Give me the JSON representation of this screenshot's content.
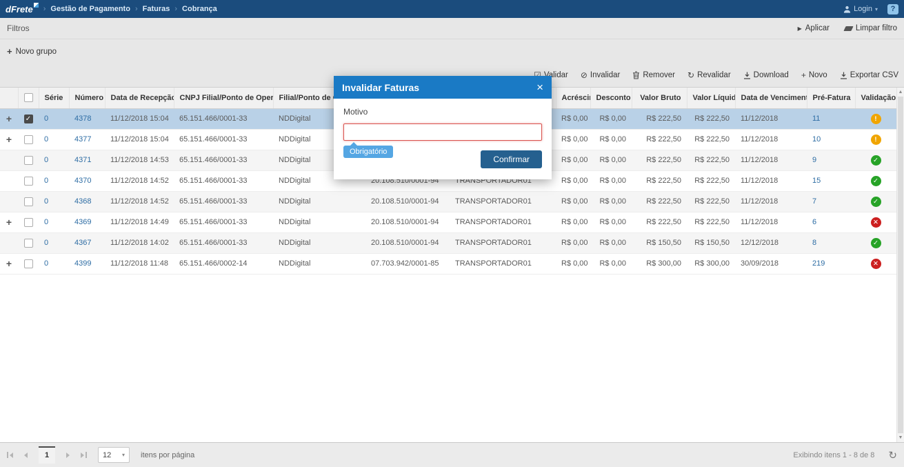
{
  "navbar": {
    "logo": "dFrete",
    "breadcrumbs": [
      "Gestão de Pagamento",
      "Faturas",
      "Cobrança"
    ],
    "login_label": "Login",
    "help_icon": "?"
  },
  "filters": {
    "title": "Filtros",
    "apply_label": "Aplicar",
    "clear_label": "Limpar filtro",
    "new_group_label": "Novo grupo"
  },
  "toolbar": {
    "actions": [
      {
        "label": "Validar",
        "icon": "check_square"
      },
      {
        "label": "Invalidar",
        "icon": "slash_circle"
      },
      {
        "label": "Remover",
        "icon": "trash"
      },
      {
        "label": "Revalidar",
        "icon": "refresh"
      },
      {
        "label": "Download",
        "icon": "download"
      },
      {
        "label": "Novo",
        "icon": "plus"
      },
      {
        "label": "Exportar CSV",
        "icon": "download"
      }
    ]
  },
  "table": {
    "columns": [
      {
        "label": "",
        "name": "expand"
      },
      {
        "label": "",
        "name": "select"
      },
      {
        "label": "Série",
        "name": "serie"
      },
      {
        "label": "Número",
        "name": "numero"
      },
      {
        "label": "Data de Recepção",
        "name": "data-recepcao",
        "sorted": "desc"
      },
      {
        "label": "CNPJ Filial/Ponto de Operação",
        "name": "cnpj-filial"
      },
      {
        "label": "Filial/Ponto de Operação",
        "name": "filial"
      },
      {
        "label": "",
        "name": "cnpj-transportador"
      },
      {
        "label": "",
        "name": "transportador"
      },
      {
        "label": "Acréscimo",
        "name": "acrescimo",
        "align": "right"
      },
      {
        "label": "Desconto",
        "name": "desconto",
        "align": "right"
      },
      {
        "label": "Valor Bruto",
        "name": "valor-bruto",
        "align": "right"
      },
      {
        "label": "Valor Líquido",
        "name": "valor-liquido",
        "align": "right"
      },
      {
        "label": "Data de Vencimento",
        "name": "data-vencimento"
      },
      {
        "label": "Pré-Fatura",
        "name": "pre-fatura"
      },
      {
        "label": "Validação",
        "name": "validacao",
        "align": "center"
      }
    ],
    "rows": [
      {
        "expand": true,
        "checked": true,
        "selected": true,
        "serie": "0",
        "numero": "4378",
        "data_recepcao": "11/12/2018 15:04",
        "cnpj_filial": "65.151.466/0001-33",
        "filial": "NDDigital",
        "cnpj_transportador": "",
        "transportador": "",
        "acrescimo": "R$ 0,00",
        "desconto": "R$ 0,00",
        "valor_bruto": "R$ 222,50",
        "valor_liquido": "R$ 222,50",
        "data_vencimento": "11/12/2018",
        "pre_fatura": "11",
        "validacao": "warning"
      },
      {
        "expand": true,
        "checked": false,
        "selected": false,
        "serie": "0",
        "numero": "4377",
        "data_recepcao": "11/12/2018 15:04",
        "cnpj_filial": "65.151.466/0001-33",
        "filial": "NDDigital",
        "cnpj_transportador": "",
        "transportador": "",
        "acrescimo": "R$ 0,00",
        "desconto": "R$ 0,00",
        "valor_bruto": "R$ 222,50",
        "valor_liquido": "R$ 222,50",
        "data_vencimento": "11/12/2018",
        "pre_fatura": "10",
        "validacao": "warning"
      },
      {
        "expand": false,
        "checked": false,
        "selected": false,
        "serie": "0",
        "numero": "4371",
        "data_recepcao": "11/12/2018 14:53",
        "cnpj_filial": "65.151.466/0001-33",
        "filial": "NDDigital",
        "cnpj_transportador": "",
        "transportador": "",
        "acrescimo": "R$ 0,00",
        "desconto": "R$ 0,00",
        "valor_bruto": "R$ 222,50",
        "valor_liquido": "R$ 222,50",
        "data_vencimento": "11/12/2018",
        "pre_fatura": "9",
        "validacao": "valid"
      },
      {
        "expand": false,
        "checked": false,
        "selected": false,
        "serie": "0",
        "numero": "4370",
        "data_recepcao": "11/12/2018 14:52",
        "cnpj_filial": "65.151.466/0001-33",
        "filial": "NDDigital",
        "cnpj_transportador": "20.108.510/0001-94",
        "transportador": "TRANSPORTADOR01",
        "acrescimo": "R$ 0,00",
        "desconto": "R$ 0,00",
        "valor_bruto": "R$ 222,50",
        "valor_liquido": "R$ 222,50",
        "data_vencimento": "11/12/2018",
        "pre_fatura": "15",
        "validacao": "valid"
      },
      {
        "expand": false,
        "checked": false,
        "selected": false,
        "serie": "0",
        "numero": "4368",
        "data_recepcao": "11/12/2018 14:52",
        "cnpj_filial": "65.151.466/0001-33",
        "filial": "NDDigital",
        "cnpj_transportador": "20.108.510/0001-94",
        "transportador": "TRANSPORTADOR01",
        "acrescimo": "R$ 0,00",
        "desconto": "R$ 0,00",
        "valor_bruto": "R$ 222,50",
        "valor_liquido": "R$ 222,50",
        "data_vencimento": "11/12/2018",
        "pre_fatura": "7",
        "validacao": "valid"
      },
      {
        "expand": true,
        "checked": false,
        "selected": false,
        "serie": "0",
        "numero": "4369",
        "data_recepcao": "11/12/2018 14:49",
        "cnpj_filial": "65.151.466/0001-33",
        "filial": "NDDigital",
        "cnpj_transportador": "20.108.510/0001-94",
        "transportador": "TRANSPORTADOR01",
        "acrescimo": "R$ 0,00",
        "desconto": "R$ 0,00",
        "valor_bruto": "R$ 222,50",
        "valor_liquido": "R$ 222,50",
        "data_vencimento": "11/12/2018",
        "pre_fatura": "6",
        "validacao": "invalid"
      },
      {
        "expand": false,
        "checked": false,
        "selected": false,
        "serie": "0",
        "numero": "4367",
        "data_recepcao": "11/12/2018 14:02",
        "cnpj_filial": "65.151.466/0001-33",
        "filial": "NDDigital",
        "cnpj_transportador": "20.108.510/0001-94",
        "transportador": "TRANSPORTADOR01",
        "acrescimo": "R$ 0,00",
        "desconto": "R$ 0,00",
        "valor_bruto": "R$ 150,50",
        "valor_liquido": "R$ 150,50",
        "data_vencimento": "12/12/2018",
        "pre_fatura": "8",
        "validacao": "valid"
      },
      {
        "expand": true,
        "checked": false,
        "selected": false,
        "serie": "0",
        "numero": "4399",
        "data_recepcao": "11/12/2018 11:48",
        "cnpj_filial": "65.151.466/0002-14",
        "filial": "NDDigital",
        "cnpj_transportador": "07.703.942/0001-85",
        "transportador": "TRANSPORTADOR01",
        "acrescimo": "R$ 0,00",
        "desconto": "R$ 0,00",
        "valor_bruto": "R$ 300,00",
        "valor_liquido": "R$ 300,00",
        "data_vencimento": "30/09/2018",
        "pre_fatura": "219",
        "validacao": "invalid"
      }
    ]
  },
  "modal": {
    "title": "Invalidar Faturas",
    "close_icon": "×",
    "field_label": "Motivo",
    "input_value": "",
    "required_tooltip": "Obrigatório",
    "confirm_label": "Confirmar"
  },
  "pagination": {
    "current_page": "1",
    "page_size": "12",
    "page_size_label": "itens por página",
    "status": "Exibindo itens 1 - 8 de 8"
  },
  "icon_glyphs": {
    "check_square": "☑",
    "slash_circle": "⊘",
    "refresh": "↻",
    "plus": "+",
    "play": "▶",
    "caret_down": "▾",
    "arrow_up": "▲",
    "arrow_down": "▼",
    "sort_desc": "↓"
  },
  "status_glyphs": {
    "warning": "!",
    "valid": "✓",
    "invalid": "✕"
  },
  "colors": {
    "navbar": "#1b4c7d",
    "modal_header": "#1a7ac5",
    "confirm_button": "#25608f",
    "required_tooltip": "#55a6e3",
    "input_error_border": "#d9534f",
    "selected_row": "#b9d1e7",
    "warning": "#f0a500",
    "valid": "#27a327",
    "invalid": "#cc1f1f"
  }
}
